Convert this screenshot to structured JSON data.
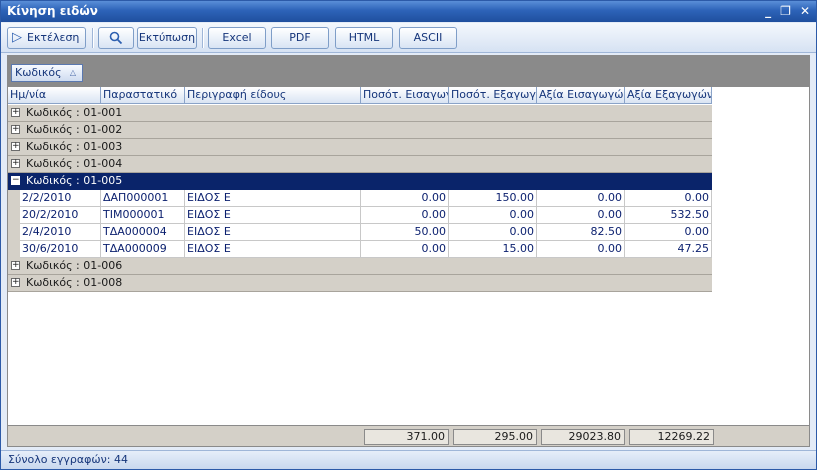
{
  "window": {
    "title": "Κίνηση ειδών",
    "controls": {
      "minimize": "_",
      "restore": "❐",
      "close": "✕"
    }
  },
  "toolbar": {
    "run_label": "Εκτέλεση",
    "run_icon": "▷",
    "search_icon": "magnifier-icon",
    "print_label": "Εκτύπωση",
    "excel_label": "Excel",
    "pdf_label": "PDF",
    "html_label": "HTML",
    "ascii_label": "ASCII"
  },
  "group_by": {
    "label": "Κωδικός",
    "sort_glyph": "△"
  },
  "columns": [
    "Ημ/νία",
    "Παραστατικό",
    "Περιγραφή είδους",
    "Ποσότ. Εισαγωγών",
    "Ποσότ. Εξαγωγών",
    "Αξία Εισαγωγών",
    "Αξία Εξαγωγών"
  ],
  "groups": [
    {
      "label": "Κωδικός : 01-001",
      "expander": "+"
    },
    {
      "label": "Κωδικός : 01-002",
      "expander": "+"
    },
    {
      "label": "Κωδικός : 01-003",
      "expander": "+"
    },
    {
      "label": "Κωδικός : 01-004",
      "expander": "+"
    },
    {
      "label": "Κωδικός : 01-005",
      "expander": "−",
      "selected": true,
      "rows": [
        [
          "2/2/2010",
          "ΔΑΠ000001",
          "ΕΙΔΟΣ Ε",
          "0.00",
          "150.00",
          "0.00",
          "0.00"
        ],
        [
          "20/2/2010",
          "ΤΙΜ000001",
          "ΕΙΔΟΣ Ε",
          "0.00",
          "0.00",
          "0.00",
          "532.50"
        ],
        [
          "2/4/2010",
          "ΤΔΑ000004",
          "ΕΙΔΟΣ Ε",
          "50.00",
          "0.00",
          "82.50",
          "0.00"
        ],
        [
          "30/6/2010",
          "ΤΔΑ000009",
          "ΕΙΔΟΣ Ε",
          "0.00",
          "15.00",
          "0.00",
          "47.25"
        ]
      ]
    },
    {
      "label": "Κωδικός : 01-006",
      "expander": "+"
    },
    {
      "label": "Κωδικός : 01-008",
      "expander": "+"
    }
  ],
  "totals": [
    "371.00",
    "295.00",
    "29023.80",
    "12269.22"
  ],
  "status": {
    "text": "Σύνολο εγγραφών: 44"
  },
  "colors": {
    "title": "#2d63b8",
    "selected_row": "#0a246a",
    "group_row": "#d4d0c8",
    "text_blue": "#0a1f6e"
  }
}
